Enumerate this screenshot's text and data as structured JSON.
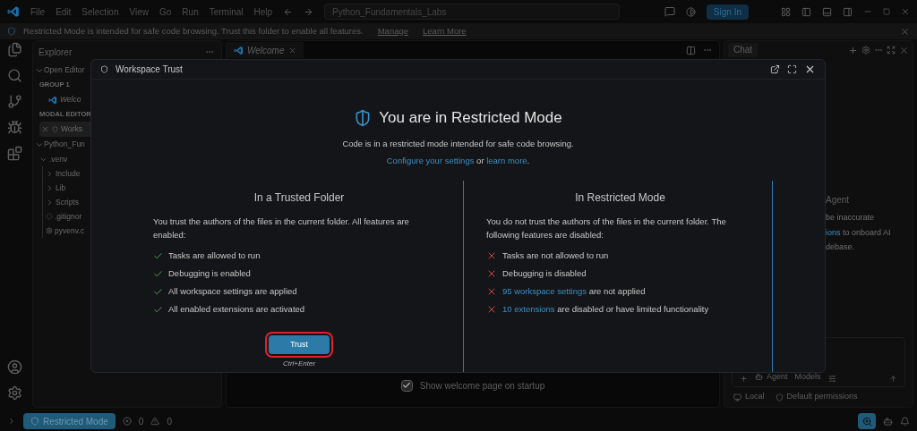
{
  "title_bar": {
    "menu": [
      "File",
      "Edit",
      "Selection",
      "View",
      "Go",
      "Run",
      "Terminal",
      "Help"
    ],
    "search": "Python_Fundamentals_Labs",
    "sign_in": "Sign In"
  },
  "banner": {
    "message": "Restricted Mode is intended for safe code browsing. Trust this folder to enable all features.",
    "links": [
      "Manage",
      "Learn More"
    ]
  },
  "explorer": {
    "title": "Explorer",
    "tree": [
      {
        "kind": "section",
        "label": "Open Editor",
        "expanded": true,
        "children": [
          {
            "kind": "group",
            "label": "GROUP 1",
            "children": [
              {
                "kind": "preview",
                "label": "Welco",
                "selected": false
              }
            ]
          },
          {
            "kind": "group",
            "label": "MODAL EDITOR",
            "children": [
              {
                "kind": "modal",
                "label": "Works",
                "selected": true
              }
            ]
          }
        ]
      },
      {
        "kind": "section",
        "label": "Python_Fun",
        "expanded": true,
        "children": [
          {
            "kind": "folder",
            "label": ".venv",
            "expanded": true,
            "children": [
              {
                "kind": "folder",
                "label": "Include",
                "expanded": false
              },
              {
                "kind": "folder",
                "label": "Lib",
                "expanded": false
              },
              {
                "kind": "folder",
                "label": "Scripts",
                "expanded": false
              },
              {
                "kind": "ignore",
                "label": ".gitignor"
              },
              {
                "kind": "config",
                "label": "pyvenv.c"
              }
            ]
          }
        ]
      }
    ]
  },
  "editor": {
    "tab": "Welcome",
    "startup_checkbox": {
      "label": "Show welcome page on startup",
      "checked": true
    }
  },
  "chat": {
    "title": "Chat",
    "heading": "Agent",
    "lines": [
      [
        {
          "text": "be inaccurate",
          "link": false
        }
      ],
      [
        {
          "text": "ions",
          "link": true
        },
        {
          "text": " to onboard AI",
          "link": false
        }
      ],
      [
        {
          "text": "debase.",
          "link": false
        }
      ]
    ],
    "modes": [
      "Agent",
      "Models"
    ],
    "footer": [
      "Local",
      "Default permissions"
    ]
  },
  "modal": {
    "title": "Workspace Trust",
    "heading": "You are in Restricted Mode",
    "subtitle": "Code is in a restricted mode intended for safe code browsing.",
    "links_line": [
      {
        "text": "Configure your settings",
        "link": true
      },
      {
        "text": " or ",
        "link": false
      },
      {
        "text": "learn more",
        "link": true
      }
    ],
    "links_line_end": ".",
    "columns": [
      {
        "title": "In a Trusted Folder",
        "description": "You trust the authors of the files in the current folder. All features are enabled:",
        "items": [
          {
            "allowed": true,
            "parts": [
              {
                "text": "Tasks are allowed to run",
                "link": false
              }
            ]
          },
          {
            "allowed": true,
            "parts": [
              {
                "text": "Debugging is enabled",
                "link": false
              }
            ]
          },
          {
            "allowed": true,
            "parts": [
              {
                "text": "All workspace settings are applied",
                "link": false
              }
            ]
          },
          {
            "allowed": true,
            "parts": [
              {
                "text": "All enabled extensions are activated",
                "link": false
              }
            ]
          }
        ],
        "button": {
          "label": "Trust",
          "highlighted": true
        },
        "shortcut": "Ctrl+Enter"
      },
      {
        "title": "In Restricted Mode",
        "description": "You do not trust the authors of the files in the current folder. The following features are disabled:",
        "items": [
          {
            "allowed": false,
            "parts": [
              {
                "text": "Tasks are not allowed to run",
                "link": false
              }
            ]
          },
          {
            "allowed": false,
            "parts": [
              {
                "text": "Debugging is disabled",
                "link": false
              }
            ]
          },
          {
            "allowed": false,
            "parts": [
              {
                "text": "95 workspace settings",
                "link": true
              },
              {
                "text": " are not applied",
                "link": false
              }
            ]
          },
          {
            "allowed": false,
            "parts": [
              {
                "text": "10 extensions",
                "link": true
              },
              {
                "text": " are disabled or have limited functionality",
                "link": false
              }
            ]
          }
        ]
      }
    ]
  },
  "status_bar": {
    "mode": "Restricted Mode",
    "errors": "0",
    "warnings": "0"
  }
}
